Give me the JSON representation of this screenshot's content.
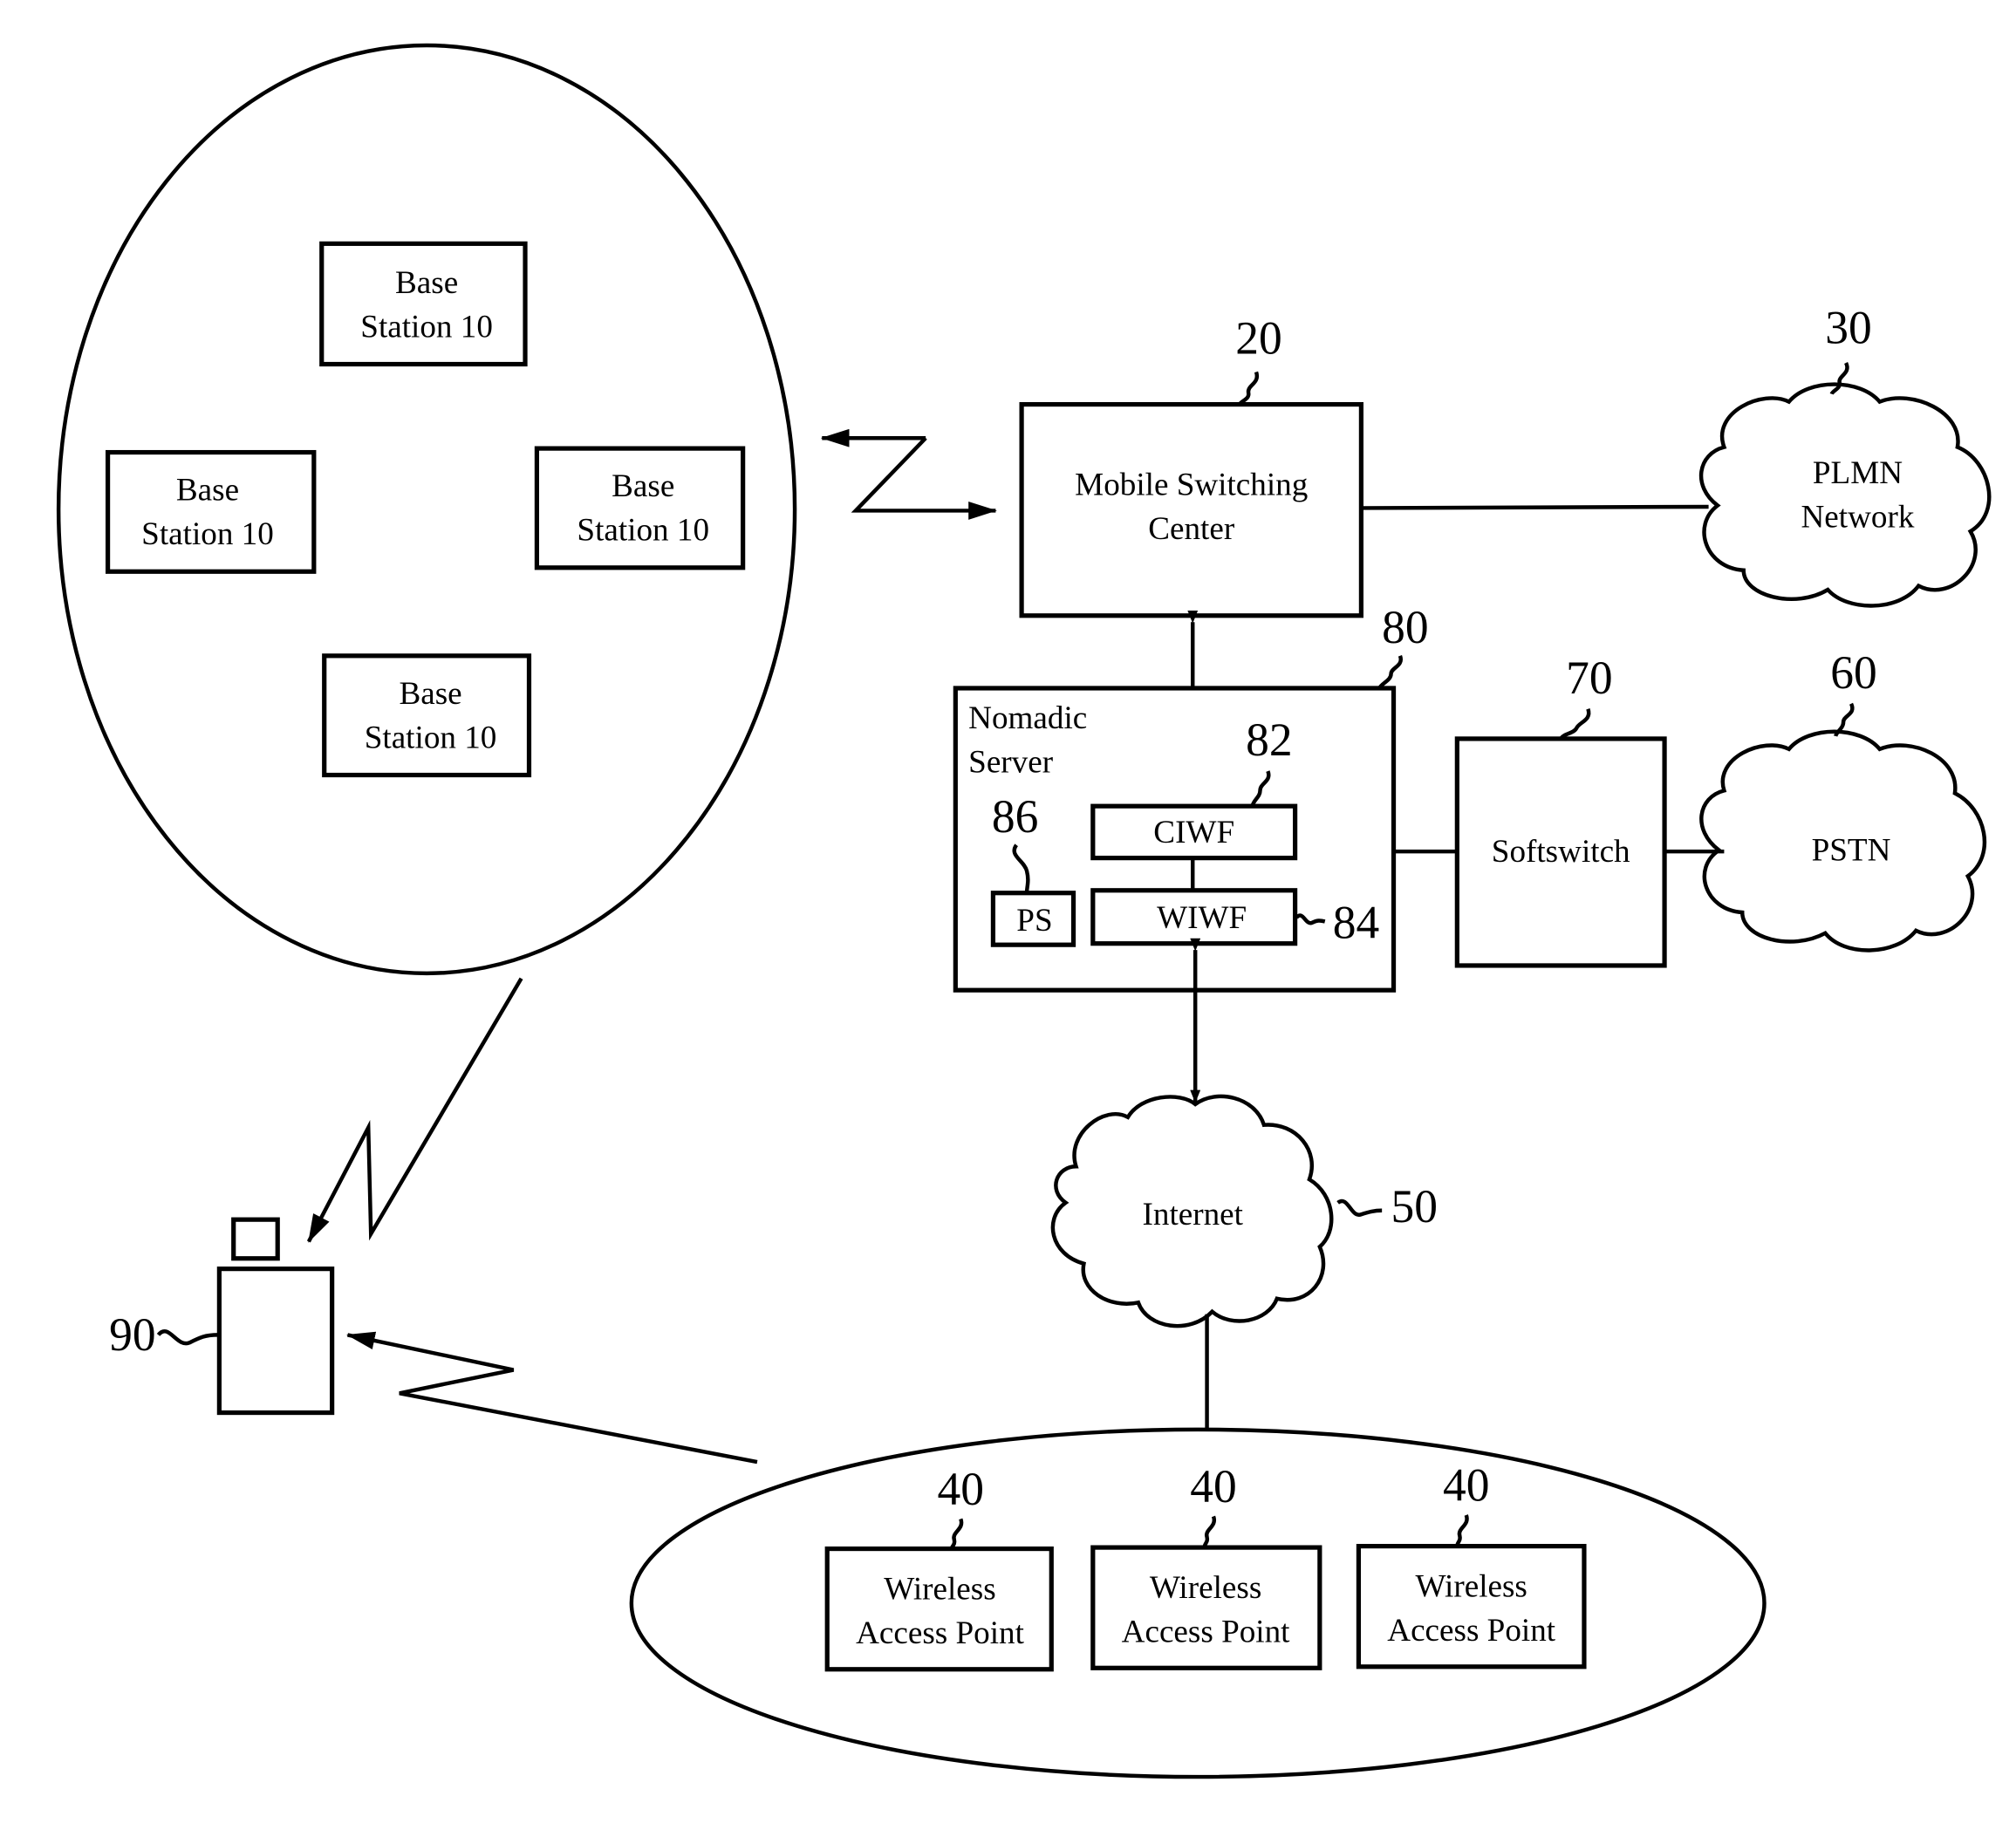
{
  "diagram": {
    "cellular_area": {
      "base_stations": [
        {
          "line1": "Base",
          "line2": "Station 10"
        },
        {
          "line1": "Base",
          "line2": "Station 10"
        },
        {
          "line1": "Base",
          "line2": "Station 10"
        },
        {
          "line1": "Base",
          "line2": "Station 10"
        }
      ]
    },
    "msc": {
      "line1": "Mobile Switching",
      "line2": "Center",
      "ref": "20"
    },
    "plmn": {
      "line1": "PLMN",
      "line2": "Network",
      "ref": "30"
    },
    "nomadic_server": {
      "line1": "Nomadic",
      "line2": "Server",
      "ref": "80",
      "ciwf": {
        "label": "CIWF",
        "ref": "82"
      },
      "wiwf": {
        "label": "WIWF",
        "ref": "84"
      },
      "ps": {
        "label": "PS",
        "ref": "86"
      }
    },
    "softswitch": {
      "label": "Softswitch",
      "ref": "70"
    },
    "pstn": {
      "label": "PSTN",
      "ref": "60"
    },
    "internet": {
      "label": "Internet",
      "ref": "50"
    },
    "wlan_area": {
      "access_points": [
        {
          "line1": "Wireless",
          "line2": "Access Point",
          "ref": "40"
        },
        {
          "line1": "Wireless",
          "line2": "Access Point",
          "ref": "40"
        },
        {
          "line1": "Wireless",
          "line2": "Access Point",
          "ref": "40"
        }
      ]
    },
    "mobile_terminal": {
      "ref": "90"
    }
  }
}
